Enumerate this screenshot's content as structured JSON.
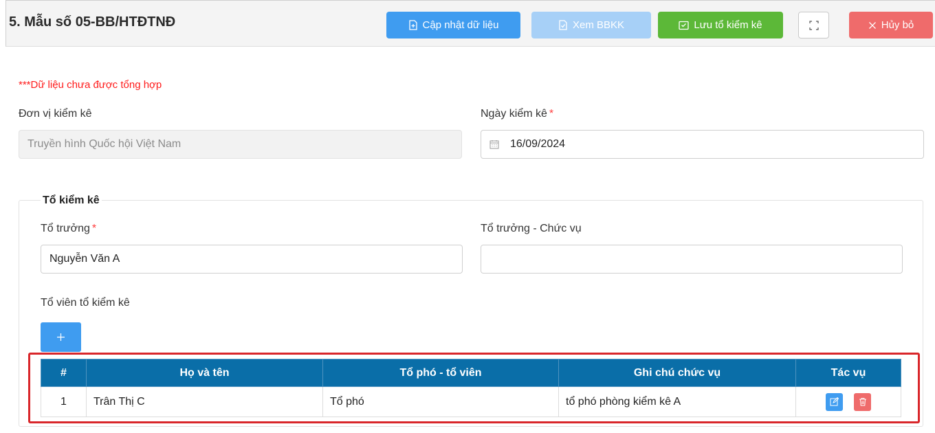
{
  "header": {
    "title": "5. Mẫu số 05-BB/HTĐTNĐ",
    "buttons": {
      "update": "Cập nhật dữ liệu",
      "view": "Xem BBKK",
      "save": "Lưu tổ kiểm kê",
      "cancel": "Hủy bỏ"
    }
  },
  "warning": "***Dữ liệu chưa được tổng hợp",
  "form": {
    "unit_label": "Đơn vị kiểm kê",
    "unit_value": "Truyền hình Quốc hội Việt Nam",
    "date_label": "Ngày kiểm kê",
    "date_value": "16/09/2024",
    "required_mark": "*"
  },
  "team": {
    "legend": "Tổ kiểm kê",
    "leader_label": "Tổ trưởng",
    "leader_value": "Nguyễn Văn A",
    "leader_position_label": "Tổ trưởng - Chức vụ",
    "leader_position_value": "",
    "members_label": "Tổ viên tổ kiểm kê"
  },
  "table": {
    "headers": [
      "#",
      "Họ và tên",
      "Tổ phó - tổ viên",
      "Ghi chú chức vụ",
      "Tác vụ"
    ],
    "rows": [
      {
        "num": "1",
        "name": "Trân Thị C",
        "role": "Tổ phó",
        "note": "tổ phó phòng kiểm kê A"
      }
    ]
  },
  "colors": {
    "primary": "#3f9cf0",
    "primary_light": "#a7d0f7",
    "success": "#5cb838",
    "danger": "#ef6b6b",
    "table_header": "#0a6ea8",
    "warning_text": "#ff1a1a",
    "highlight": "#d9262a"
  }
}
